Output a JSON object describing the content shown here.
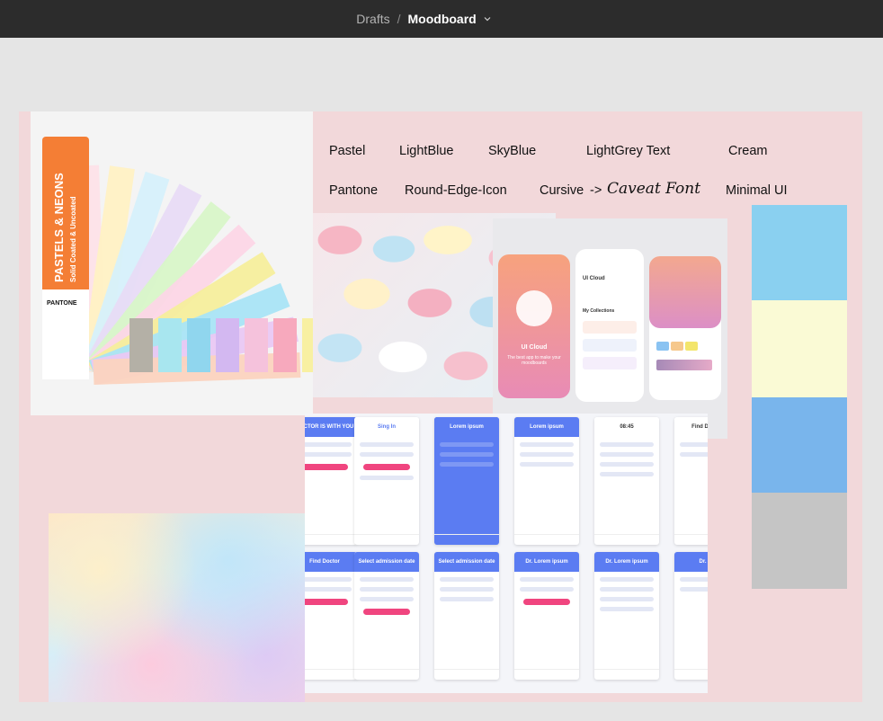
{
  "topbar": {
    "breadcrumb_parent": "Drafts",
    "separator": "/",
    "file_name": "Moodboard"
  },
  "board": {
    "labels": [
      "Pastel",
      "LightBlue",
      "SkyBlue",
      "LightGrey Text",
      "Cream",
      "Pantone",
      "Round-Edge-Icon",
      "Cursive",
      "->",
      "Caveat Font",
      "Minimal UI"
    ],
    "pantone": {
      "title": "PASTELS & NEONS",
      "subtitle": "Solid Coated & Uncoated",
      "brand": "PANTONE"
    },
    "ui_cloud": {
      "title": "UI Cloud",
      "collections": "My Collections",
      "tagline": "The best app to make your moodboards"
    },
    "doctor_app": {
      "screen_titles": [
        "DOCTOR IS WITH YOU",
        "Sing In",
        "Lorem ipsum",
        "Lorem ipsum",
        "08:45",
        "Find Doctor",
        "Find Doctor",
        "Select admission date",
        "Select admission date",
        "Dr. Lorem ipsum",
        "Dr. Lorem ipsum",
        "Dr. Lo"
      ]
    },
    "swatches": [
      {
        "name": "LightBlue",
        "color": "#8ad0f0"
      },
      {
        "name": "Cream",
        "color": "#fafad5"
      },
      {
        "name": "SkyBlue",
        "color": "#79b5ec"
      },
      {
        "name": "LightGrey",
        "color": "#c5c5c5"
      }
    ]
  }
}
